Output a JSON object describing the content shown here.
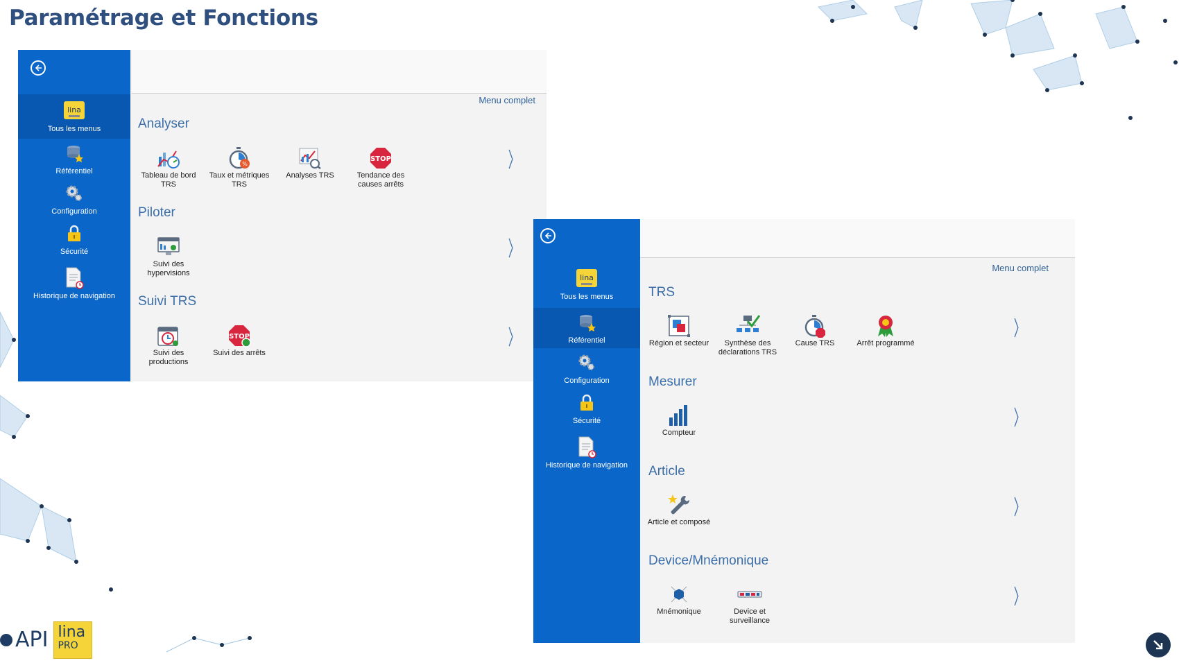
{
  "page_title": "Paramétrage et Fonctions",
  "colors": {
    "title": "#2f4f7f",
    "sidebar": "#0a66c8",
    "section": "#3b6ea8",
    "panel": "#f3f3f3"
  },
  "panel_left": {
    "back_icon": "back-arrow-circle-icon",
    "nav": [
      {
        "label": "Tous les menus",
        "icon": "lina-logo-icon",
        "active": true
      },
      {
        "label": "Référentiel",
        "icon": "database-star-icon",
        "active": false
      },
      {
        "label": "Configuration",
        "icon": "gears-icon",
        "active": false
      },
      {
        "label": "Sécurité",
        "icon": "padlock-icon",
        "active": false
      },
      {
        "label": "Historique de navigation",
        "icon": "document-clock-icon",
        "active": false
      }
    ],
    "menu_complet": "Menu complet",
    "sections": [
      {
        "title": "Analyser",
        "tiles": [
          {
            "label": "Tableau de bord TRS",
            "icon": "dashboard-chart-icon"
          },
          {
            "label": "Taux et métriques TRS",
            "icon": "stopwatch-percent-icon"
          },
          {
            "label": "Analyses TRS",
            "icon": "chart-analysis-icon"
          },
          {
            "label": "Tendance des causes arrêts",
            "icon": "stop-sign-icon"
          }
        ]
      },
      {
        "title": "Piloter",
        "tiles": [
          {
            "label": "Suivi des hypervisions",
            "icon": "monitor-icon"
          }
        ]
      },
      {
        "title": "Suivi TRS",
        "tiles": [
          {
            "label": "Suivi des productions",
            "icon": "calendar-clock-icon"
          },
          {
            "label": "Suivi des arrêts",
            "icon": "stop-clock-icon"
          }
        ]
      }
    ],
    "chevron": "〉"
  },
  "panel_right": {
    "back_icon": "back-arrow-circle-icon",
    "nav": [
      {
        "label": "Tous les menus",
        "icon": "lina-logo-icon",
        "active": false
      },
      {
        "label": "Référentiel",
        "icon": "database-star-icon",
        "active": true
      },
      {
        "label": "Configuration",
        "icon": "gears-icon",
        "active": false
      },
      {
        "label": "Sécurité",
        "icon": "padlock-icon",
        "active": false
      },
      {
        "label": "Historique de navigation",
        "icon": "document-clock-icon",
        "active": false
      }
    ],
    "menu_complet": "Menu complet",
    "sections": [
      {
        "title": "TRS",
        "tiles": [
          {
            "label": "Région et secteur",
            "icon": "region-squares-icon"
          },
          {
            "label": "Synthèse des déclarations TRS",
            "icon": "hierarchy-check-icon"
          },
          {
            "label": "Cause TRS",
            "icon": "stopwatch-stop-icon"
          },
          {
            "label": "Arrêt programmé",
            "icon": "award-ribbon-icon"
          }
        ]
      },
      {
        "title": "Mesurer",
        "tiles": [
          {
            "label": "Compteur",
            "icon": "bar-counter-icon"
          }
        ]
      },
      {
        "title": "Article",
        "tiles": [
          {
            "label": "Article et composé",
            "icon": "wrench-star-icon"
          }
        ]
      },
      {
        "title": "Device/Mnémonique",
        "tiles": [
          {
            "label": "Mnémonique",
            "icon": "network-node-icon"
          },
          {
            "label": "Device et surveillance",
            "icon": "device-icon"
          }
        ]
      }
    ],
    "chevron": "〉"
  },
  "footer": {
    "api_text": "API",
    "lina_text": "lina",
    "pro_text": "PRO",
    "corner_icon": "arrow-down-right-icon"
  }
}
